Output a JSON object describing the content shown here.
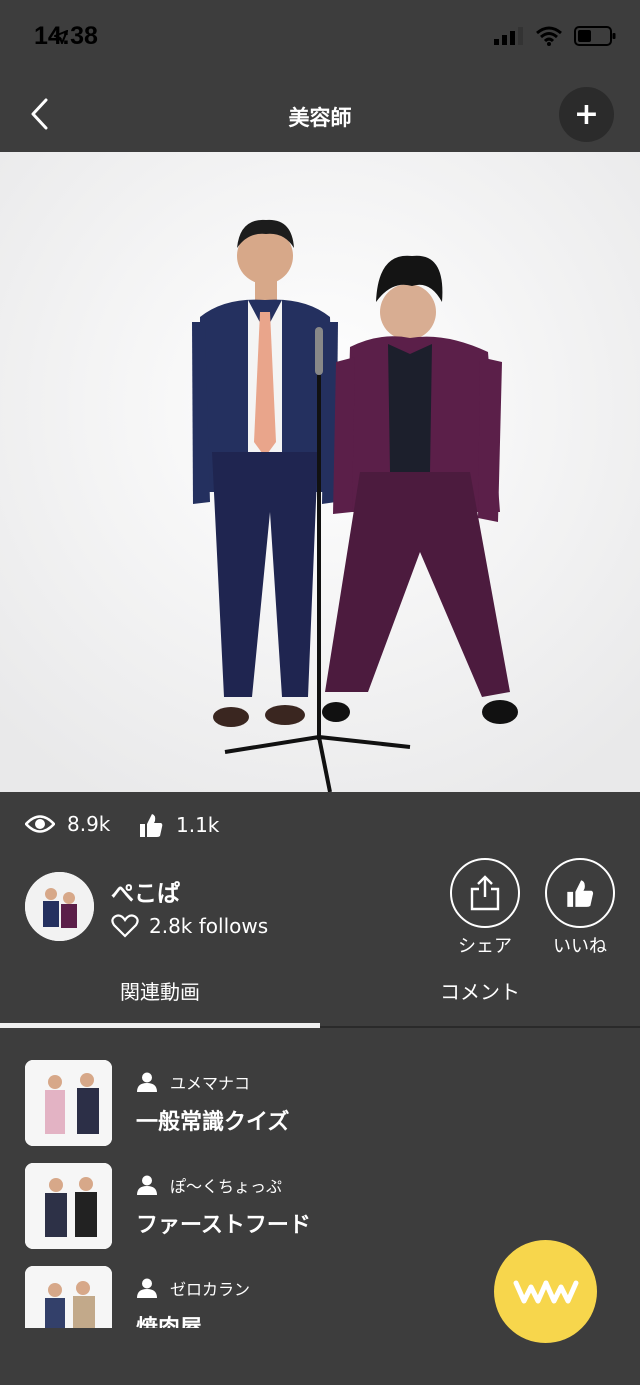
{
  "status": {
    "time": "14:38"
  },
  "nav": {
    "title": "美容師",
    "back_icon": "chevron-left-icon",
    "add_label": "+"
  },
  "video": {
    "description_icon": "video-frame"
  },
  "stats": {
    "views": "8.9k",
    "likes": "1.1k"
  },
  "channel": {
    "name": "ぺこぱ",
    "follows": "2.8k follows"
  },
  "actions": {
    "share": "シェア",
    "like": "いいね"
  },
  "tabs": [
    {
      "label": "関連動画",
      "active": true
    },
    {
      "label": "コメント",
      "active": false
    }
  ],
  "related": [
    {
      "author": "ユメマナコ",
      "title": "一般常識クイズ"
    },
    {
      "author": "ぽ〜くちょっぷ",
      "title": "ファーストフード"
    },
    {
      "author": "ゼロカラン",
      "title": "焼肉屋"
    }
  ],
  "colors": {
    "background": "#3d3d3d",
    "accent": "#f7d64c",
    "video_bg": "#f3f3f3"
  }
}
